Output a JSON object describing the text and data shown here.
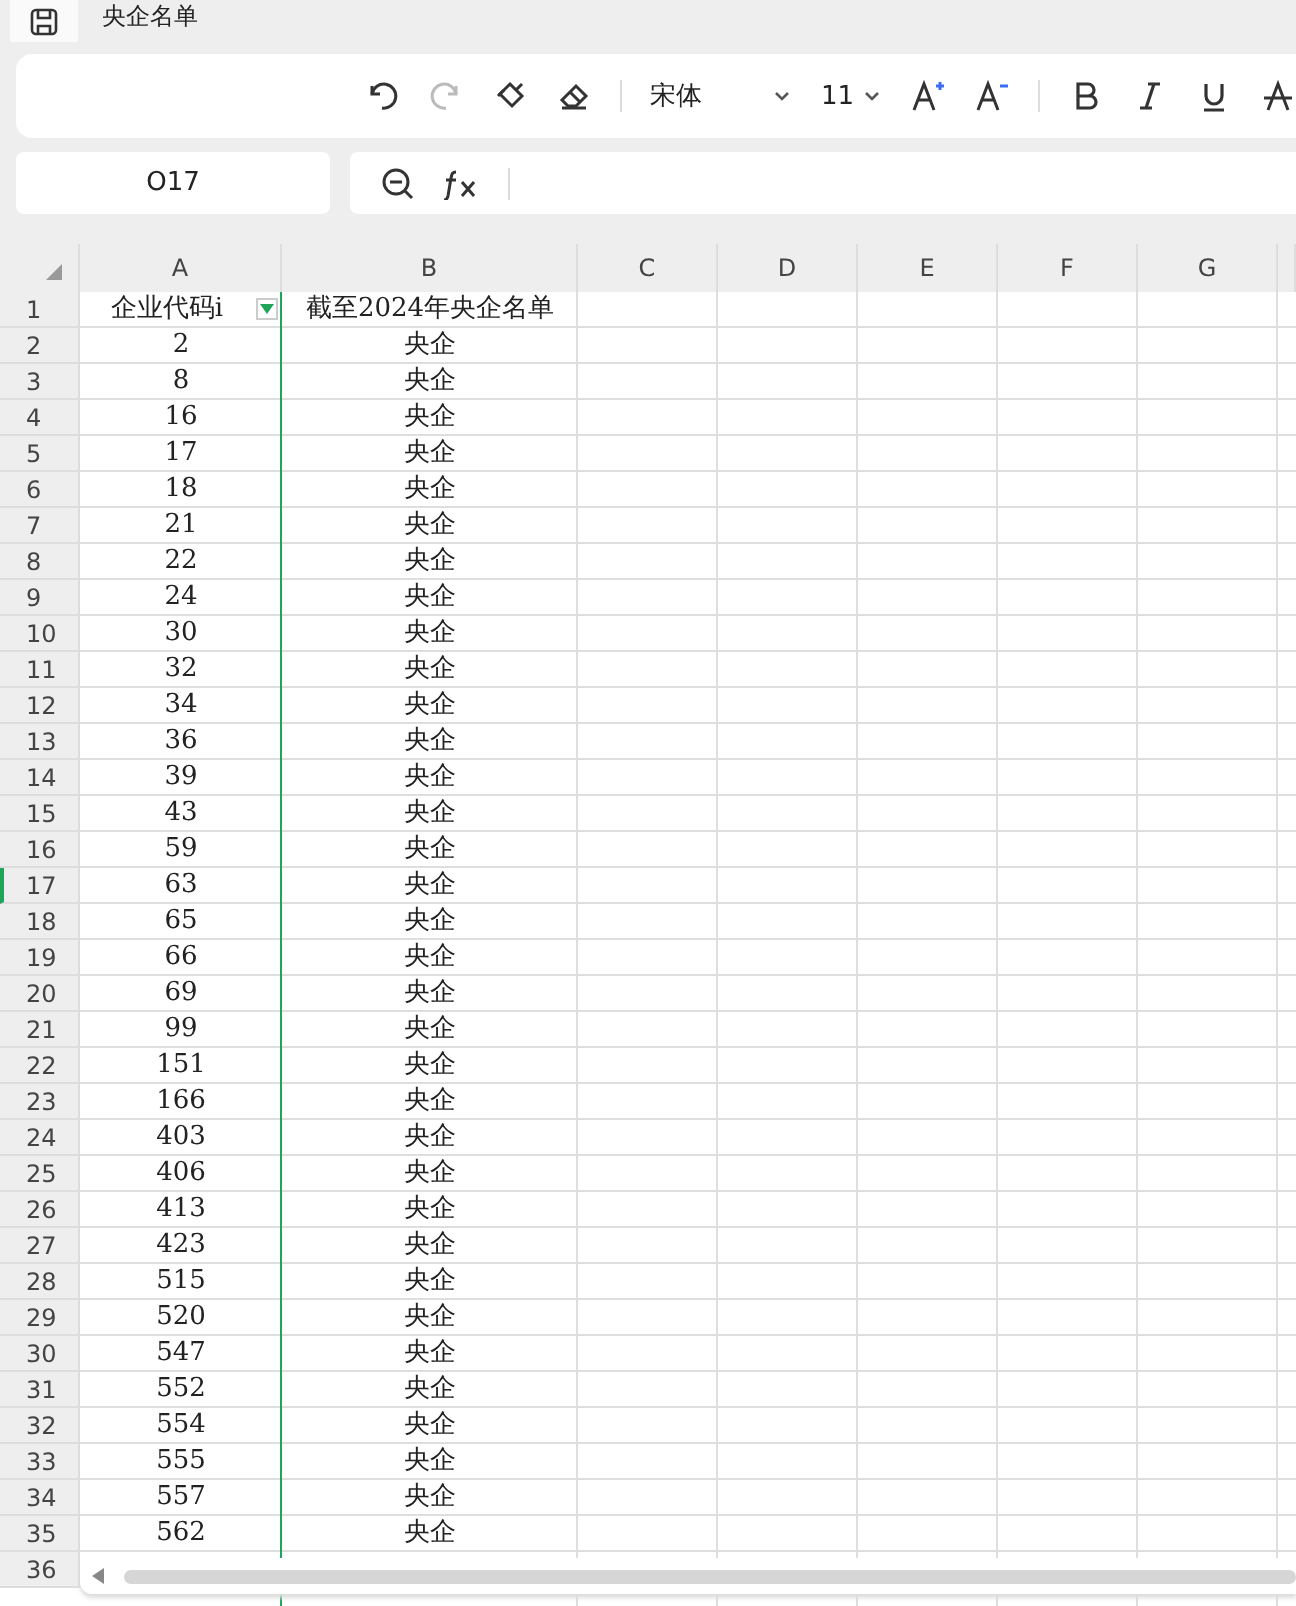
{
  "title": "央企名单",
  "toolbar": {
    "font": "宋体",
    "size": "11"
  },
  "name_box": "O17",
  "columns": [
    "A",
    "B",
    "C",
    "D",
    "E",
    "F",
    "G"
  ],
  "header_row": {
    "row": "1",
    "cells": [
      "企业代码i",
      "截至2024年央企名单"
    ],
    "filter": true
  },
  "rows": [
    {
      "row": "2",
      "cells": [
        "2",
        "央企"
      ],
      "selected": false
    },
    {
      "row": "3",
      "cells": [
        "8",
        "央企"
      ],
      "selected": false
    },
    {
      "row": "4",
      "cells": [
        "16",
        "央企"
      ],
      "selected": false
    },
    {
      "row": "5",
      "cells": [
        "17",
        "央企"
      ],
      "selected": false
    },
    {
      "row": "6",
      "cells": [
        "18",
        "央企"
      ],
      "selected": false
    },
    {
      "row": "7",
      "cells": [
        "21",
        "央企"
      ],
      "selected": false
    },
    {
      "row": "8",
      "cells": [
        "22",
        "央企"
      ],
      "selected": false
    },
    {
      "row": "9",
      "cells": [
        "24",
        "央企"
      ],
      "selected": false
    },
    {
      "row": "10",
      "cells": [
        "30",
        "央企"
      ],
      "selected": false
    },
    {
      "row": "11",
      "cells": [
        "32",
        "央企"
      ],
      "selected": false
    },
    {
      "row": "12",
      "cells": [
        "34",
        "央企"
      ],
      "selected": false
    },
    {
      "row": "13",
      "cells": [
        "36",
        "央企"
      ],
      "selected": false
    },
    {
      "row": "14",
      "cells": [
        "39",
        "央企"
      ],
      "selected": false
    },
    {
      "row": "15",
      "cells": [
        "43",
        "央企"
      ],
      "selected": false
    },
    {
      "row": "16",
      "cells": [
        "59",
        "央企"
      ],
      "selected": false
    },
    {
      "row": "17",
      "cells": [
        "63",
        "央企"
      ],
      "selected": true
    },
    {
      "row": "18",
      "cells": [
        "65",
        "央企"
      ],
      "selected": false
    },
    {
      "row": "19",
      "cells": [
        "66",
        "央企"
      ],
      "selected": false
    },
    {
      "row": "20",
      "cells": [
        "69",
        "央企"
      ],
      "selected": false
    },
    {
      "row": "21",
      "cells": [
        "99",
        "央企"
      ],
      "selected": false
    },
    {
      "row": "22",
      "cells": [
        "151",
        "央企"
      ],
      "selected": false
    },
    {
      "row": "23",
      "cells": [
        "166",
        "央企"
      ],
      "selected": false
    },
    {
      "row": "24",
      "cells": [
        "403",
        "央企"
      ],
      "selected": false
    },
    {
      "row": "25",
      "cells": [
        "406",
        "央企"
      ],
      "selected": false
    },
    {
      "row": "26",
      "cells": [
        "413",
        "央企"
      ],
      "selected": false
    },
    {
      "row": "27",
      "cells": [
        "423",
        "央企"
      ],
      "selected": false
    },
    {
      "row": "28",
      "cells": [
        "515",
        "央企"
      ],
      "selected": false
    },
    {
      "row": "29",
      "cells": [
        "520",
        "央企"
      ],
      "selected": false
    },
    {
      "row": "30",
      "cells": [
        "547",
        "央企"
      ],
      "selected": false
    },
    {
      "row": "31",
      "cells": [
        "552",
        "央企"
      ],
      "selected": false
    },
    {
      "row": "32",
      "cells": [
        "554",
        "央企"
      ],
      "selected": false
    },
    {
      "row": "33",
      "cells": [
        "555",
        "央企"
      ],
      "selected": false
    },
    {
      "row": "34",
      "cells": [
        "557",
        "央企"
      ],
      "selected": false
    },
    {
      "row": "35",
      "cells": [
        "562",
        "央企"
      ],
      "selected": false
    },
    {
      "row": "36",
      "cells": [],
      "selected": false
    }
  ]
}
